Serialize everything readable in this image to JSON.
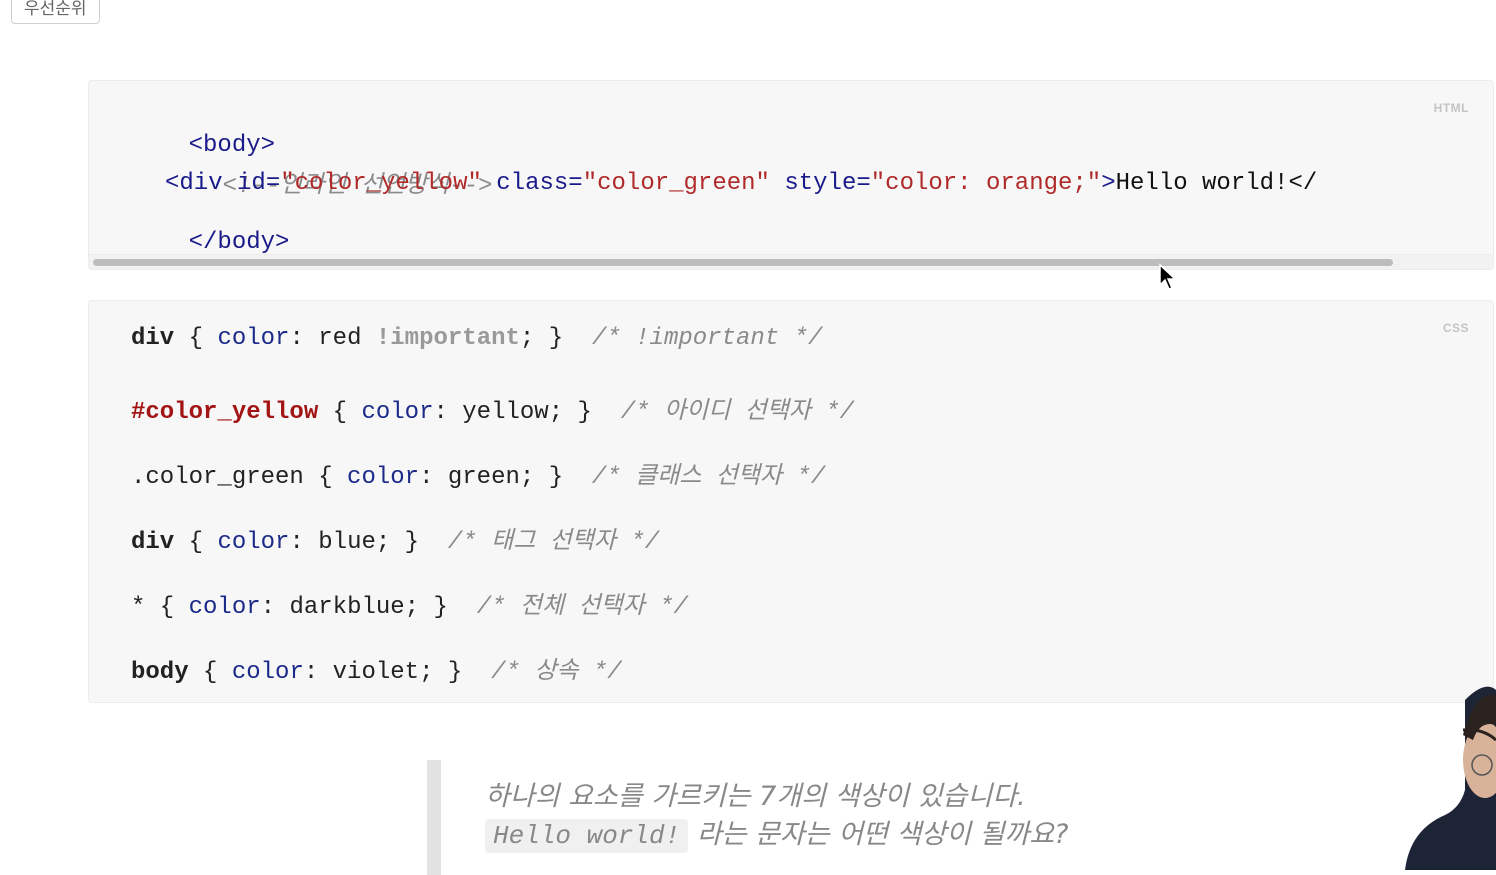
{
  "tag_chip": "우선순위",
  "html_block": {
    "lang": "HTML",
    "line1": "<body>",
    "comment": "<!--인라인 선언방식-->",
    "div_open": "<div",
    "id_attr": "id=",
    "id_val": "\"color_yellow\"",
    "class_attr": "class=",
    "class_val": "\"color_green\"",
    "style_attr": "style=",
    "style_val": "\"color: orange;\"",
    "gt": ">",
    "content": "Hello world!</",
    "line_end": "</body>"
  },
  "css_block": {
    "lang": "CSS",
    "rules": [
      {
        "selector": "div",
        "open": " { ",
        "prop": "color",
        "colon": ": ",
        "value": "red ",
        "important": "!important",
        "close": "; }",
        "comment": "/* !important */"
      },
      {
        "selector": "#color_yellow",
        "open": " { ",
        "prop": "color",
        "colon": ": ",
        "value": "yellow",
        "close": "; }",
        "comment": "/* 아이디 선택자 */"
      },
      {
        "selector": ".color_green",
        "open": " { ",
        "prop": "color",
        "colon": ": ",
        "value": "green",
        "close": "; }",
        "comment": "/* 클래스 선택자 */"
      },
      {
        "selector": "div",
        "open": " { ",
        "prop": "color",
        "colon": ": ",
        "value": "blue",
        "close": "; }",
        "comment": "/* 태그 선택자 */"
      },
      {
        "selector": "*",
        "open": " { ",
        "prop": "color",
        "colon": ": ",
        "value": "darkblue",
        "close": "; }",
        "comment": "/* 전체 선택자 */"
      },
      {
        "selector": "body",
        "open": " { ",
        "prop": "color",
        "colon": ": ",
        "value": "violet",
        "close": "; }",
        "comment": "/* 상속 */"
      }
    ]
  },
  "quote": {
    "line1": "하나의 요소를 가르키는 7개의 색상이 있습니다.",
    "code": "Hello world!",
    "line2_rest": "라는 문자는 어떤 색상이 될까요?"
  }
}
